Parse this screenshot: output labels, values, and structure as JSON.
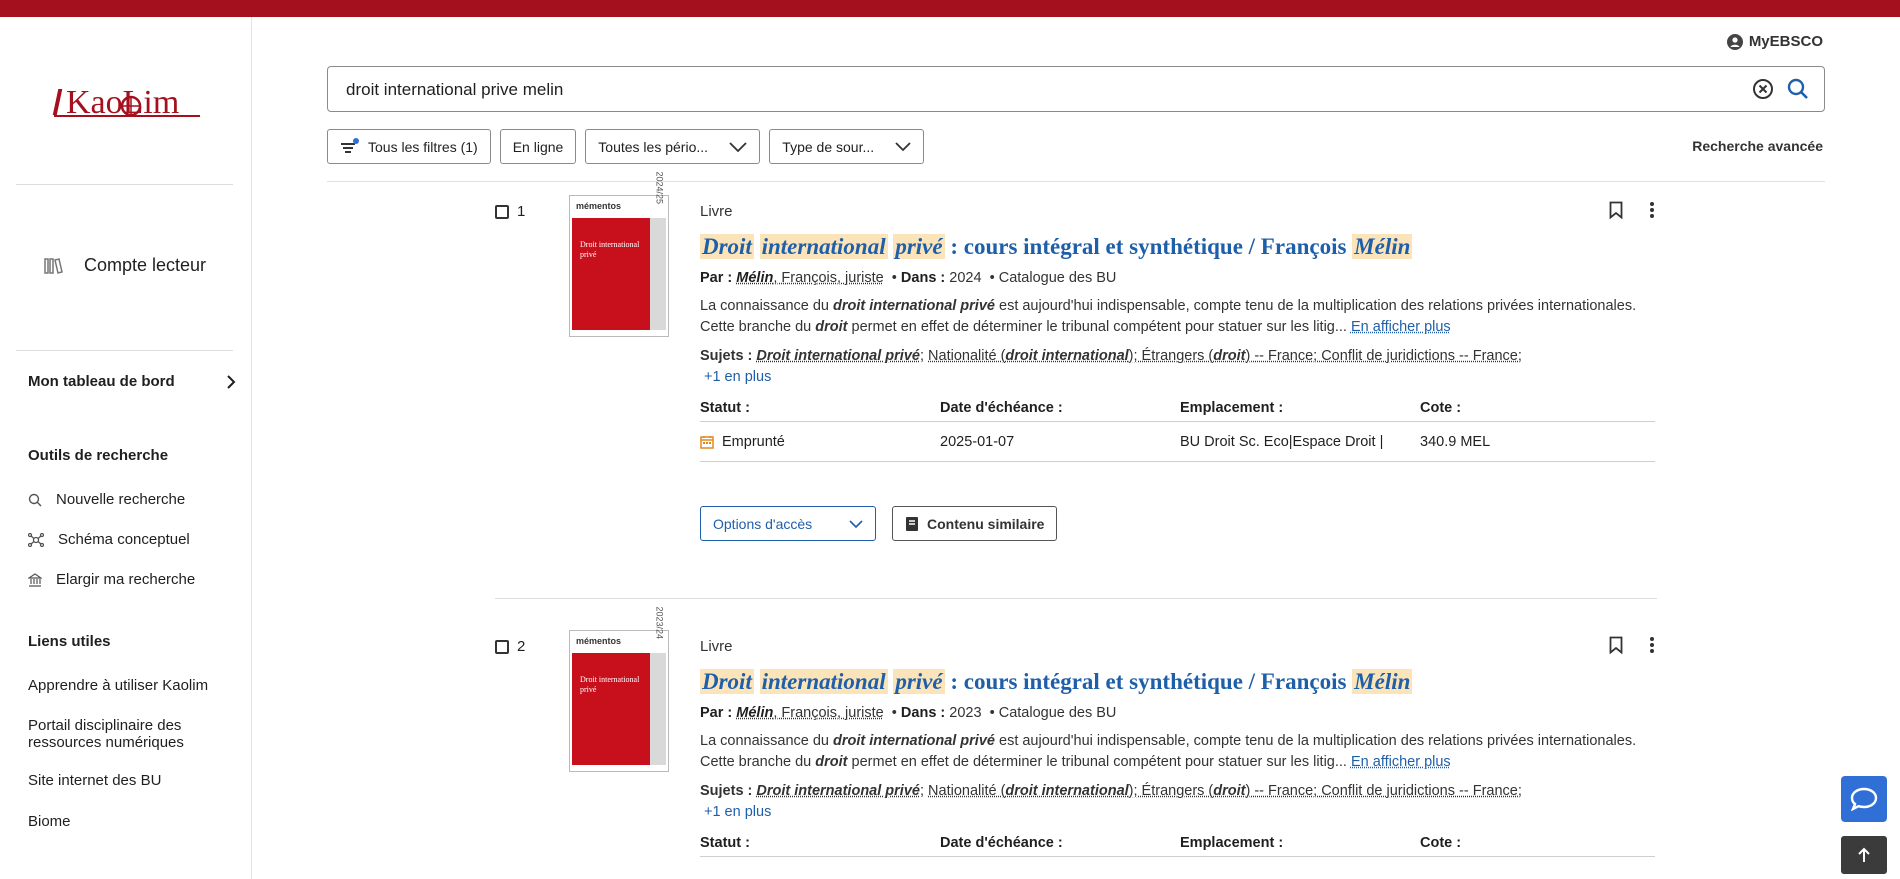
{
  "header": {
    "myebsco": "MyEBSCO"
  },
  "sidebar": {
    "logo_text": "KaoLim",
    "account": "Compte lecteur",
    "dashboard": "Mon tableau de bord",
    "tools_heading": "Outils de recherche",
    "tools": [
      "Nouvelle recherche",
      "Schéma conceptuel",
      "Elargir ma recherche"
    ],
    "links_heading": "Liens utiles",
    "links": [
      "Apprendre à utiliser Kaolim",
      "Portail disciplinaire des ressources numériques",
      "Site internet des BU",
      "Biome"
    ]
  },
  "search": {
    "query": "droit international prive melin"
  },
  "filters": {
    "all": "Tous les filtres (1)",
    "online": "En ligne",
    "period": "Toutes les pério...",
    "source": "Type de sour...",
    "advanced": "Recherche avancée"
  },
  "labels": {
    "by": "Par :",
    "in": "Dans :",
    "subjects": "Sujets :",
    "more_subjects": "+1 en plus",
    "show_more": "En afficher plus",
    "status": "Statut :",
    "due": "Date d'échéance :",
    "location": "Emplacement :",
    "callno": "Cote :",
    "access": "Options d'accès",
    "similar": "Contenu similaire"
  },
  "results": [
    {
      "index": "1",
      "type": "Livre",
      "title_hl1": "Droit",
      "title_hl2": "international",
      "title_hl3": "privé",
      "title_mid": ": cours intégral et synthétique / François",
      "title_hl4": "Mélin",
      "author_hl": "Mélin",
      "author_rest": ", François, juriste",
      "year": "2024",
      "catalog": "Catalogue des BU",
      "abs_1": "La connaissance du",
      "abs_b1": "droit international privé",
      "abs_2": "est aujourd'hui indispensable, compte tenu de la multiplication des relations privées internationales. Cette branche du",
      "abs_b2": "droit",
      "abs_3": "permet en effet de déterminer le tribunal compétent pour statuer sur les litig...",
      "subj_1": "Droit international privé",
      "subj_2": "Nationalité (",
      "subj_3": "droit international",
      "subj_4": "); Étrangers (",
      "subj_5": "droit",
      "subj_6": ") -- France; Conflit de juridictions -- France;",
      "status": "Emprunté",
      "due": "2025-01-07",
      "location": "BU Droit Sc. Eco|Espace Droit |",
      "callno": "340.9 MEL",
      "thumb_brand": "mémentos",
      "thumb_title": "Droit international privé",
      "thumb_year": "2024/25"
    },
    {
      "index": "2",
      "type": "Livre",
      "title_hl1": "Droit",
      "title_hl2": "international",
      "title_hl3": "privé",
      "title_mid": ": cours intégral et synthétique / François",
      "title_hl4": "Mélin",
      "author_hl": "Mélin",
      "author_rest": ", François, juriste",
      "year": "2023",
      "catalog": "Catalogue des BU",
      "abs_1": "La connaissance du",
      "abs_b1": "droit international privé",
      "abs_2": "est aujourd'hui indispensable, compte tenu de la multiplication des relations privées internationales. Cette branche du",
      "abs_b2": "droit",
      "abs_3": "permet en effet de déterminer le tribunal compétent pour statuer sur les litig...",
      "subj_1": "Droit international privé",
      "subj_2": "Nationalité (",
      "subj_3": "droit international",
      "subj_4": "); Étrangers (",
      "subj_5": "droit",
      "subj_6": ") -- France; Conflit de juridictions -- France;",
      "thumb_brand": "mémentos",
      "thumb_title": "Droit international privé",
      "thumb_year": "2023/24"
    }
  ],
  "colors": {
    "brand_red": "#a5101e",
    "link_blue": "#1f5fa9",
    "highlight": "#fbe4b9"
  }
}
